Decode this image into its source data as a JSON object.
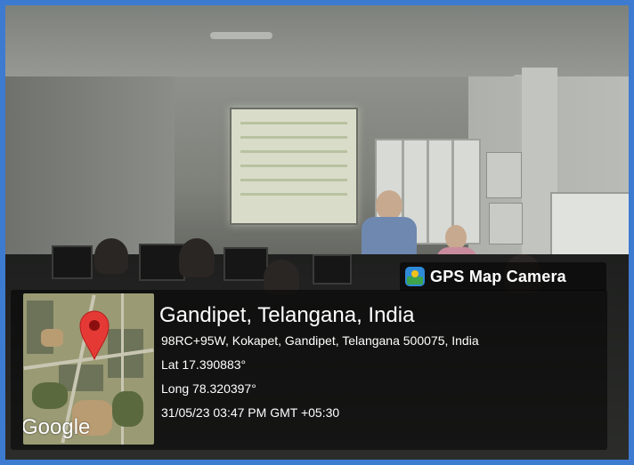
{
  "photo": {
    "description_icons": [
      "projector-screen",
      "classroom",
      "presenter"
    ]
  },
  "watermark": {
    "app_icon": "gps-map-camera-icon",
    "app_name": "GPS Map Camera",
    "map_pin_icon": "map-pin-icon",
    "map_brand": "Google",
    "location_title": "Gandipet, Telangana, India",
    "address": "98RC+95W, Kokapet, Gandipet, Telangana 500075, India",
    "latitude": "Lat 17.390883°",
    "longitude": "Long 78.320397°",
    "datetime": "31/05/23 03:47 PM GMT +05:30"
  },
  "colors": {
    "frame_border": "#3d7bd0",
    "pin": "#e53935",
    "overlay_text": "#ffffff"
  }
}
